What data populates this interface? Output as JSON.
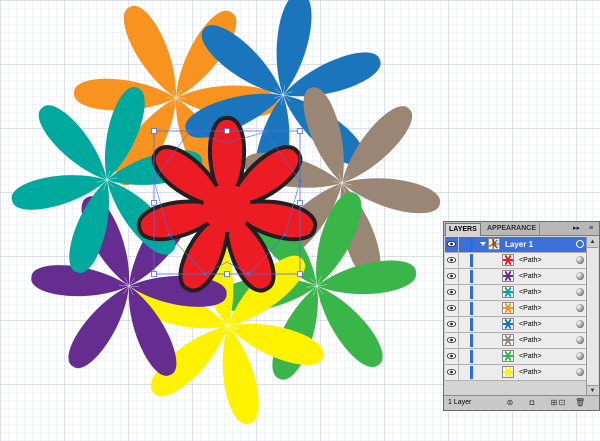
{
  "artwork": {
    "grid_color": "#d3d8e2",
    "grid_major_color": "#b9c0cd",
    "outer_flowers": [
      {
        "name": "orange",
        "color": "#f7931e"
      },
      {
        "name": "blue",
        "color": "#1b75bc"
      },
      {
        "name": "taupe",
        "color": "#998675"
      },
      {
        "name": "green",
        "color": "#39b54a"
      },
      {
        "name": "yellow",
        "color": "#fff200"
      },
      {
        "name": "purple",
        "color": "#662d91"
      },
      {
        "name": "teal",
        "color": "#00a99d"
      }
    ],
    "center_flower": {
      "name": "red",
      "color": "#ed1c24",
      "stroke": "#231f20"
    },
    "selection_color": "#4a6fd8"
  },
  "layers_panel": {
    "tabs": [
      "LAYERS",
      "APPEARANCE"
    ],
    "active_tab": "LAYERS",
    "layer": {
      "name": "Layer 1",
      "color": "#2d6be0"
    },
    "paths": [
      {
        "label": "<Path>",
        "color": "#ed1c24",
        "selected": true
      },
      {
        "label": "<Path>",
        "color": "#662d91",
        "selected": false
      },
      {
        "label": "<Path>",
        "color": "#00a99d",
        "selected": false
      },
      {
        "label": "<Path>",
        "color": "#f7931e",
        "selected": false
      },
      {
        "label": "<Path>",
        "color": "#1b75bc",
        "selected": false
      },
      {
        "label": "<Path>",
        "color": "#998675",
        "selected": false
      },
      {
        "label": "<Path>",
        "color": "#39b54a",
        "selected": false
      },
      {
        "label": "<Path>",
        "color": "#fff200",
        "selected": false
      }
    ],
    "footer": {
      "layer_count": "1 Layer"
    },
    "icons": [
      "eye-icon",
      "twisty-icon",
      "target-icon",
      "make-clipping-mask-icon",
      "new-sublayer-icon",
      "new-layer-icon",
      "delete-icon",
      "panel-menu-icon",
      "collapse-icon"
    ]
  }
}
